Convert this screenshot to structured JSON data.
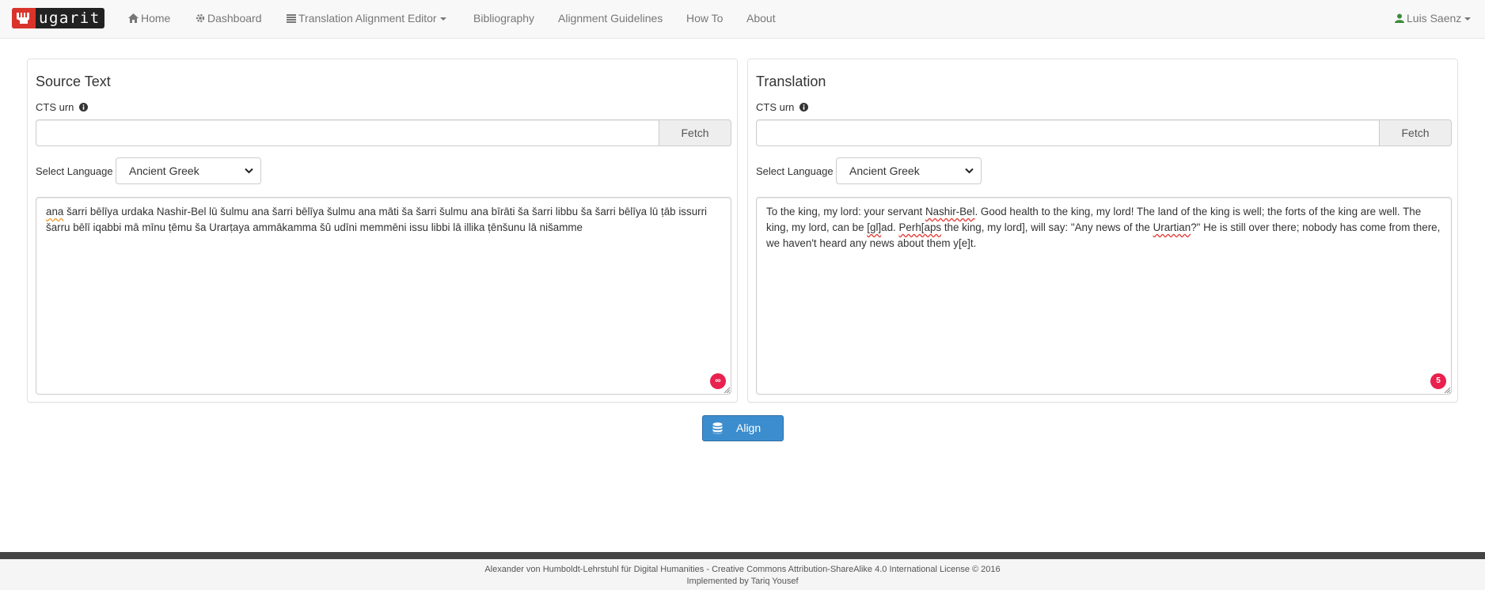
{
  "nav": {
    "logo": "ugarit",
    "items": [
      {
        "label": "Home",
        "icon": "home-icon"
      },
      {
        "label": "Dashboard",
        "icon": "gear-icon"
      },
      {
        "label": "Translation Alignment Editor",
        "icon": "list-icon"
      },
      {
        "label": "Bibliography"
      },
      {
        "label": "Alignment Guidelines"
      },
      {
        "label": "How To"
      },
      {
        "label": "About"
      }
    ],
    "user": "Luis Saenz"
  },
  "source": {
    "title": "Source Text",
    "urn_label": "CTS urn",
    "urn_value": "",
    "fetch_label": "Fetch",
    "language_label": "Select Language",
    "language_selected": "Ancient Greek",
    "text_first_word": "ana",
    "text_rest": " šarri bēlīya urdaka Nashir-Bel lū šulmu ana šarri bēlīya šulmu ana māti ša šarri šulmu ana bīrāti ša šarri libbu ša šarri bēlīya lū ṭāb issurri šarru bēlī iqabbi mā mīnu ṭēmu ša Urarṭaya ammākamma šû udīni memmēni issu libbi lā illika ṭēnšunu lā nišamme",
    "badge": "∞"
  },
  "translation": {
    "title": "Translation",
    "urn_label": "CTS urn",
    "urn_value": "",
    "fetch_label": "Fetch",
    "language_label": "Select Language",
    "language_selected": "Ancient Greek",
    "text_parts": [
      "To the king, my lord: your servant ",
      "Nashir-Bel",
      ". Good health to the king, my lord! The land of the king is well; the forts of the king are well. The king, my lord, can be ",
      "[gl]",
      "ad. ",
      "Perh[aps",
      " the king, my lord], will say: \"Any news of the ",
      "Urartian",
      "?\" He is still over there; nobody has come from there, we haven't heard any news about them y[e]t."
    ],
    "badge": "5"
  },
  "align_label": "Align",
  "footer": {
    "line1": "Alexander von Humboldt-Lehrstuhl für Digital Humanities - Creative Commons Attribution-ShareAlike 4.0 International License © 2016",
    "line2": "Implemented by Tariq Yousef"
  },
  "colors": {
    "brand_red": "#d9342b",
    "primary_blue": "#3c8dce",
    "badge_pink": "#e8214f",
    "user_green": "#3c8b3c"
  }
}
